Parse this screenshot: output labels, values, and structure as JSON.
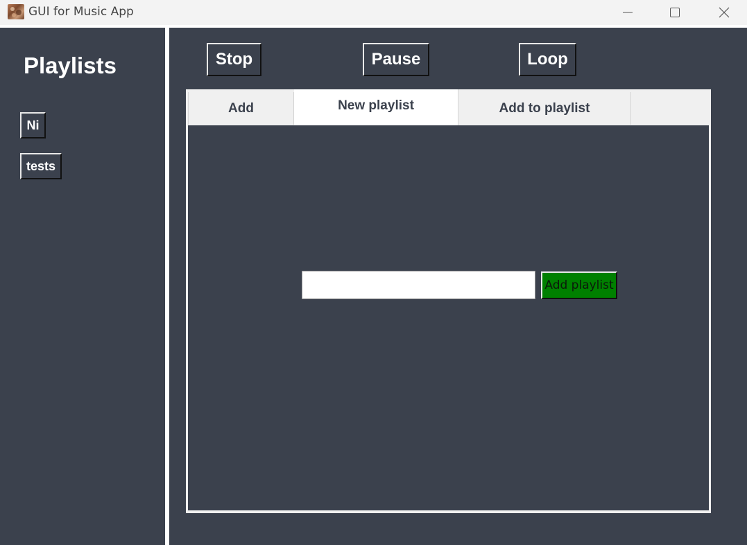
{
  "window": {
    "title": "GUI for Music App",
    "icon": "app-icon"
  },
  "window_controls": {
    "minimize_icon": "minimize-icon",
    "maximize_icon": "maximize-icon",
    "close_icon": "close-icon"
  },
  "sidebar": {
    "title": "Playlists",
    "playlists": [
      {
        "label": "Ni"
      },
      {
        "label": "tests"
      }
    ]
  },
  "controls": {
    "stop_label": "Stop",
    "pause_label": "Pause",
    "loop_label": "Loop"
  },
  "tabs": [
    {
      "label": "Add",
      "selected": false
    },
    {
      "label": "New playlist",
      "selected": true
    },
    {
      "label": "Add to playlist",
      "selected": false
    }
  ],
  "new_playlist": {
    "input_value": "",
    "add_button_label": "Add playlist"
  },
  "colors": {
    "background": "#3b414d",
    "add_button": "#008000",
    "text_light": "#ffffff"
  }
}
